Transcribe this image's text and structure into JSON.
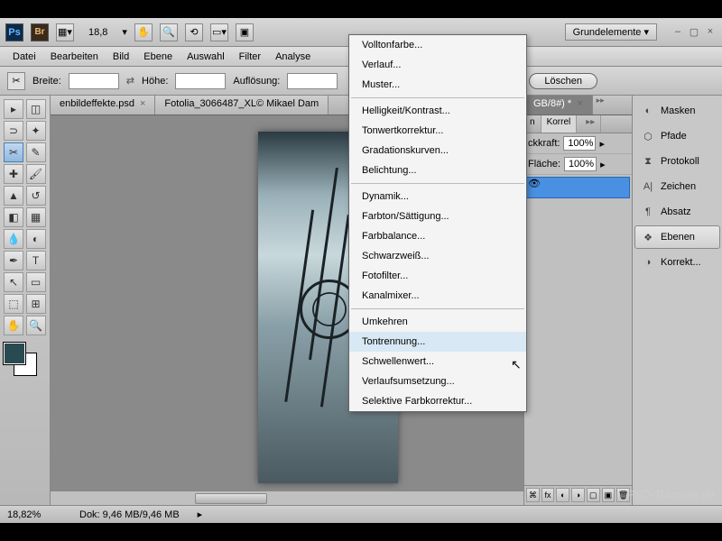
{
  "titlebar": {
    "zoom": "18,8",
    "workspace": "Grundelemente ▾"
  },
  "menu": [
    "Datei",
    "Bearbeiten",
    "Bild",
    "Ebene",
    "Auswahl",
    "Filter",
    "Analyse"
  ],
  "options": {
    "breite_label": "Breite:",
    "hoehe_label": "Höhe:",
    "aufl_label": "Auflösung:",
    "breite": "",
    "hoehe": "",
    "aufl": "",
    "delete": "Löschen"
  },
  "tabs": [
    {
      "label": "enbildeffekte.psd",
      "active": false
    },
    {
      "label": "Fotolia_3066487_XL© Mikael Dam",
      "active": false
    },
    {
      "label": "GB/8#) *",
      "active": true
    }
  ],
  "status": {
    "zoom": "18,82%",
    "doc": "Dok: 9,46 MB/9,46 MB"
  },
  "panels": {
    "tab1": "n",
    "tab2": "Korrel",
    "deckkraft_label": "ckkraft:",
    "deckkraft": "100%",
    "flaeche_label": "Fläche:",
    "flaeche": "100%"
  },
  "side_panels": [
    {
      "label": "Masken",
      "active": false
    },
    {
      "label": "Pfade",
      "active": false
    },
    {
      "label": "Protokoll",
      "active": false
    },
    {
      "label": "Zeichen",
      "active": false
    },
    {
      "label": "Absatz",
      "active": false
    },
    {
      "label": "Ebenen",
      "active": true
    },
    {
      "label": "Korrekt...",
      "active": false
    }
  ],
  "dropdown": {
    "g1": [
      "Volltonfarbe...",
      "Verlauf...",
      "Muster..."
    ],
    "g2": [
      "Helligkeit/Kontrast...",
      "Tonwertkorrektur...",
      "Gradationskurven...",
      "Belichtung..."
    ],
    "g3": [
      "Dynamik...",
      "Farbton/Sättigung...",
      "Farbbalance...",
      "Schwarzweiß...",
      "Fotofilter...",
      "Kanalmixer..."
    ],
    "g4": [
      "Umkehren",
      "Tontrennung...",
      "Schwellenwert...",
      "Verlaufsumsetzung...",
      "Selektive Farbkorrektur..."
    ],
    "hover": "Tontrennung..."
  },
  "watermark": "PSD-Tutorials.de"
}
